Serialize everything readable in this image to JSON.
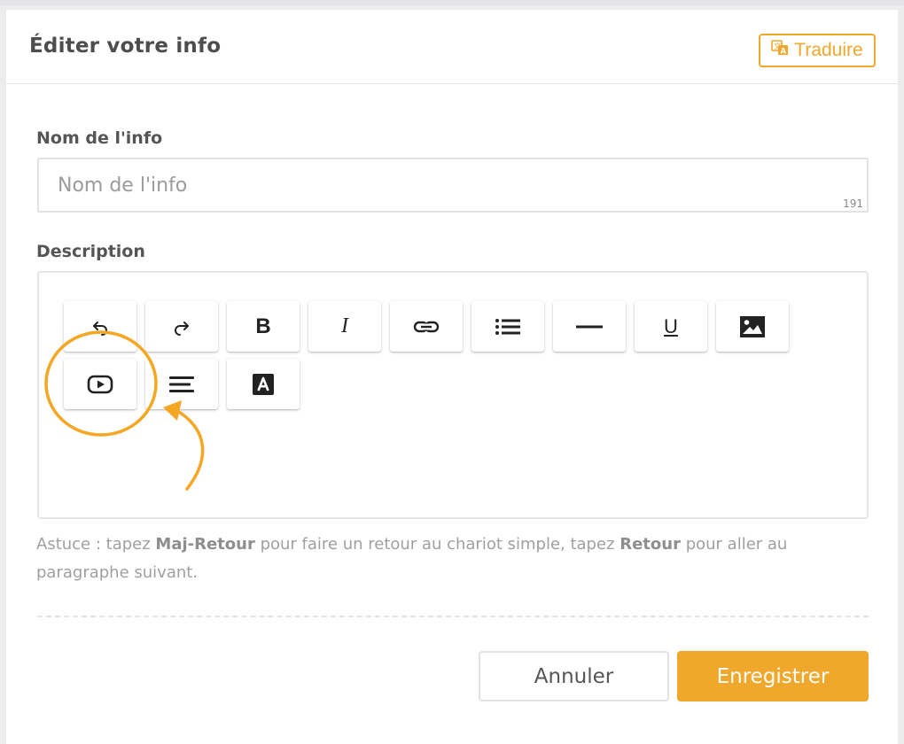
{
  "header": {
    "title": "Éditer votre info",
    "translate_label": "Traduire"
  },
  "form": {
    "name_label": "Nom de l'info",
    "name_placeholder": "Nom de l'info",
    "name_value": "",
    "name_counter": "191",
    "description_label": "Description"
  },
  "toolbar": {
    "row1": [
      "undo-icon",
      "redo-icon",
      "bold-icon",
      "italic-icon",
      "link-icon",
      "bullet-list-icon",
      "horizontal-rule-icon",
      "underline-icon",
      "image-icon"
    ],
    "row2": [
      "video-icon",
      "align-icon",
      "text-color-icon"
    ],
    "bold_glyph": "B",
    "italic_glyph": "I",
    "underline_glyph": "U"
  },
  "tip": {
    "part1": "Astuce : tapez ",
    "key1": "Maj-Retour",
    "part2": " pour faire un retour au chariot simple, tapez ",
    "key2": "Retour",
    "part3": " pour aller au paragraphe suivant."
  },
  "actions": {
    "cancel_label": "Annuler",
    "save_label": "Enregistrer"
  },
  "colors": {
    "accent": "#efa72c",
    "highlight_annotation": "#f5a623"
  }
}
